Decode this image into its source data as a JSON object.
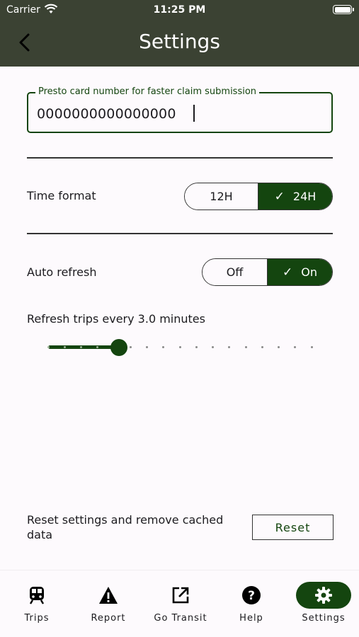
{
  "status_bar": {
    "carrier": "Carrier",
    "time": "11:25 PM"
  },
  "app_bar": {
    "title": "Settings"
  },
  "presto": {
    "label": "Presto card number for faster claim submission",
    "value": "0000000000000000"
  },
  "time_format": {
    "label": "Time format",
    "options": [
      "12H",
      "24H"
    ],
    "selected": "24H"
  },
  "auto_refresh": {
    "label": "Auto refresh",
    "options": [
      "Off",
      "On"
    ],
    "selected": "On"
  },
  "refresh_slider": {
    "label": "Refresh trips every 3.0 minutes",
    "value": 3.0,
    "fraction": 0.27
  },
  "reset": {
    "text": "Reset settings and remove cached data",
    "button_label": "Reset"
  },
  "nav": {
    "items": [
      {
        "label": "Trips",
        "icon": "train-icon"
      },
      {
        "label": "Report",
        "icon": "warning-icon"
      },
      {
        "label": "Go Transit",
        "icon": "open-external-icon"
      },
      {
        "label": "Help",
        "icon": "help-icon"
      },
      {
        "label": "Settings",
        "icon": "gear-icon"
      }
    ],
    "active": "Settings"
  },
  "colors": {
    "primary": "#14450f",
    "app_bar": "#3b4233",
    "background": "#fdfafd"
  }
}
